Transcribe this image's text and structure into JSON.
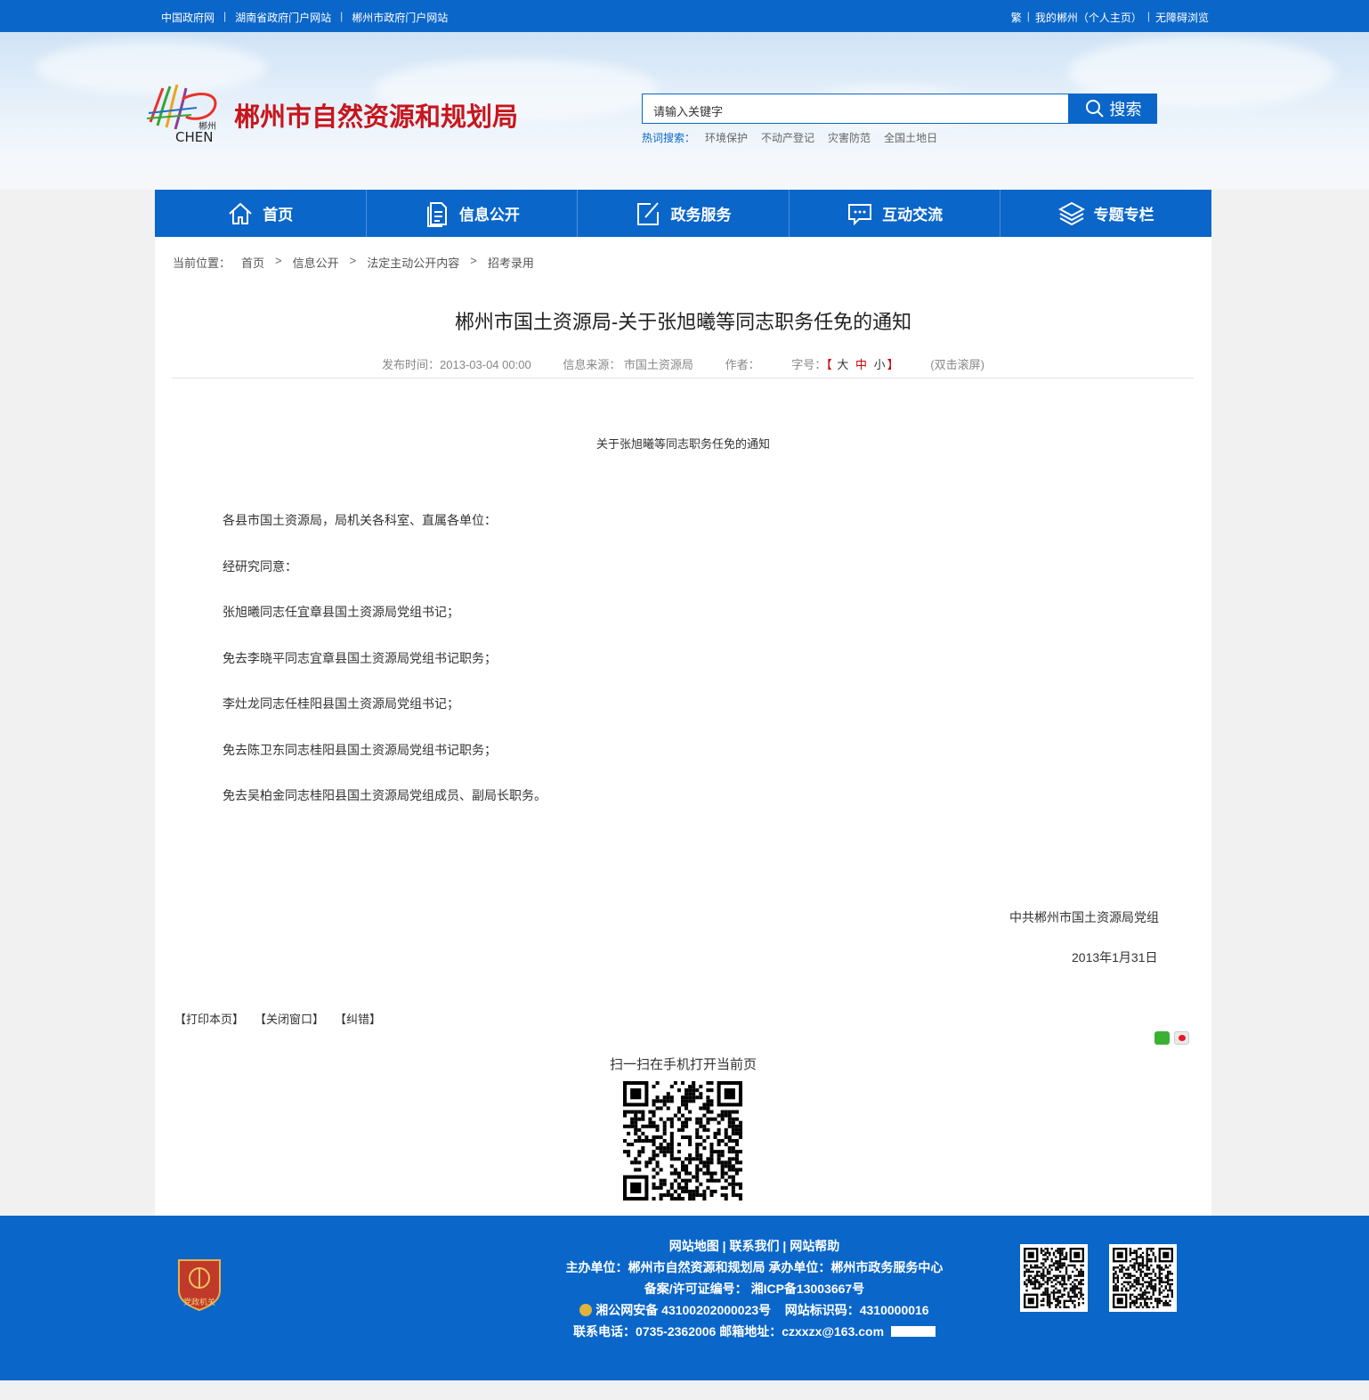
{
  "topbar": {
    "links": [
      "中国政府网",
      "湖南省政府门户网站",
      "郴州市政府门户网站"
    ],
    "right": {
      "trad": "繁",
      "my": "我的郴州（个人主页）",
      "access": "无障碍浏览"
    }
  },
  "header": {
    "logo_text": "郴州",
    "logo_en": "CHEN",
    "site_title": "郴州市自然资源和规划局",
    "search_placeholder": "请输入关键字",
    "search_button": "搜索",
    "hot_label": "热词搜索：",
    "hot_words": [
      "环境保护",
      "不动产登记",
      "灾害防范",
      "全国土地日"
    ]
  },
  "nav": [
    {
      "label": "首页",
      "icon": "home-icon"
    },
    {
      "label": "信息公开",
      "icon": "document-icon"
    },
    {
      "label": "政务服务",
      "icon": "edit-icon"
    },
    {
      "label": "互动交流",
      "icon": "chat-icon"
    },
    {
      "label": "专题专栏",
      "icon": "layers-icon"
    }
  ],
  "breadcrumb": {
    "label": "当前位置：",
    "items": [
      "首页",
      "信息公开",
      "法定主动公开内容",
      "招考录用"
    ],
    "sep": ">"
  },
  "article": {
    "title": "郴州市国土资源局-关于张旭曦等同志职务任免的通知",
    "publish": "发布时间：2013-03-04 00:00",
    "source": "信息来源： 市国土资源局",
    "author": "作者：",
    "fontsize_label": "字号：",
    "fs_open": "【",
    "fs_large": "大",
    "fs_mid": "中",
    "fs_small": "小",
    "fs_close": "】",
    "dblclick": "(双击滚屏)",
    "doc_title": "关于张旭曦等同志职务任免的通知",
    "paragraphs": [
      "各县市国土资源局，局机关各科室、直属各单位：",
      "经研究同意：",
      "张旭曦同志任宜章县国土资源局党组书记；",
      "免去李晓平同志宜章县国土资源局党组书记职务；",
      "李灶龙同志任桂阳县国土资源局党组书记；",
      "免去陈卫东同志桂阳县国土资源局党组书记职务；",
      "免去吴柏金同志桂阳县国土资源局党组成员、副局长职务。"
    ],
    "signature": "中共郴州市国土资源局党组",
    "date": "2013年1月31日"
  },
  "tools": {
    "print": "【打印本页】",
    "close": "【关闭窗口】",
    "correct": "【纠错】"
  },
  "scan_text": "扫一扫在手机打开当前页",
  "footer": {
    "badge_text": "党政机关",
    "links": [
      "网站地图",
      "联系我们",
      "网站帮助"
    ],
    "host": "主办单位：郴州市自然资源和规划局    承办单位：郴州市政务服务中心",
    "icp": "备案/许可证编号： 湘ICP备13003667号",
    "police": "湘公网安备 43100202000023号",
    "site_code": "网站标识码：4310000016",
    "contact": "联系电话：0735-2362006    邮箱地址：czxxzx@163.com"
  },
  "colors": {
    "primary": "#0a66c9",
    "title_red": "#c7161e"
  }
}
